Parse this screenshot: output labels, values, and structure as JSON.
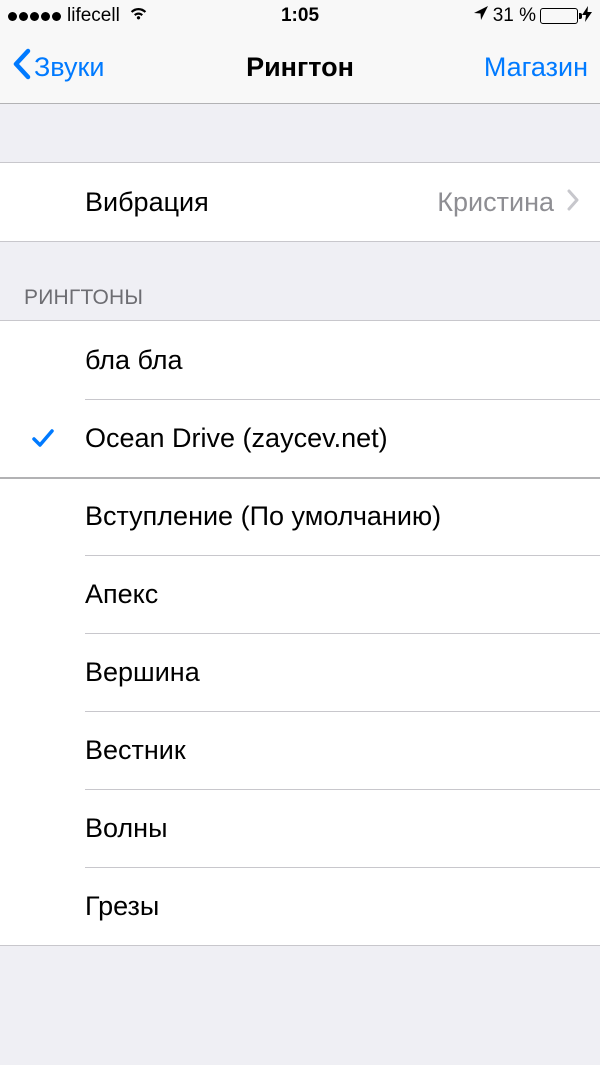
{
  "status": {
    "carrier": "lifecell",
    "time": "1:05",
    "battery_text": "31 %",
    "battery_percent": 31
  },
  "nav": {
    "back_label": "Звуки",
    "title": "Рингтон",
    "right_label": "Магазин"
  },
  "vibration": {
    "label": "Вибрация",
    "value": "Кристина"
  },
  "section_header": "РИНГТОНЫ",
  "ringtones": [
    {
      "label": "бла бла",
      "selected": false,
      "group_break": false
    },
    {
      "label": "Ocean Drive (zaycev.net)",
      "selected": true,
      "group_break": false
    },
    {
      "label": "Вступление (По умолчанию)",
      "selected": false,
      "group_break": true
    },
    {
      "label": "Апекс",
      "selected": false,
      "group_break": false
    },
    {
      "label": "Вершина",
      "selected": false,
      "group_break": false
    },
    {
      "label": "Вестник",
      "selected": false,
      "group_break": false
    },
    {
      "label": "Волны",
      "selected": false,
      "group_break": false
    },
    {
      "label": "Грезы",
      "selected": false,
      "group_break": false
    }
  ]
}
